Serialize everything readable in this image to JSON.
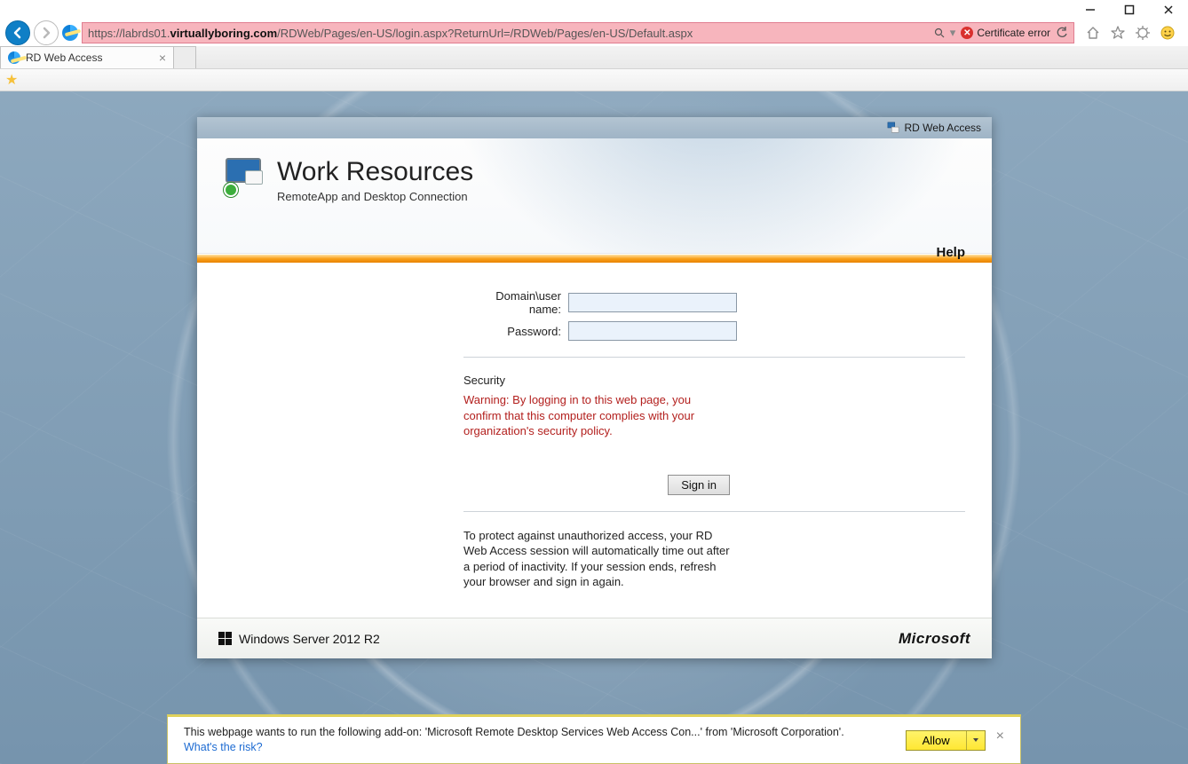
{
  "window": {
    "minimize": "—",
    "maximize": "▢",
    "close": "✕"
  },
  "browser": {
    "url_prefix": "https://",
    "url_host_dim": "labrds01.",
    "url_host_bold": "virtuallyboring.com",
    "url_path": "/RDWeb/Pages/en-US/login.aspx?ReturnUrl=/RDWeb/Pages/en-US/Default.aspx",
    "cert_error": "Certificate error",
    "tab_title": "RD Web Access"
  },
  "header": {
    "tag": "RD Web Access",
    "title": "Work Resources",
    "subtitle": "RemoteApp and Desktop Connection",
    "help": "Help"
  },
  "form": {
    "user_label": "Domain\\user name:",
    "pass_label": "Password:",
    "signin": "Sign in"
  },
  "security": {
    "title": "Security",
    "warning": "Warning: By logging in to this web page, you confirm that this computer complies with your organization's security policy."
  },
  "note": "To protect against unauthorized access, your RD Web Access session will automatically time out after a period of inactivity. If your session ends, refresh your browser and sign in again.",
  "footer": {
    "product": "Windows Server 2012 R2",
    "vendor": "Microsoft"
  },
  "notif": {
    "text": "This webpage wants to run the following add-on: 'Microsoft Remote Desktop Services Web Access Con...' from 'Microsoft Corporation'.",
    "link": "What's the risk?",
    "allow": "Allow"
  }
}
